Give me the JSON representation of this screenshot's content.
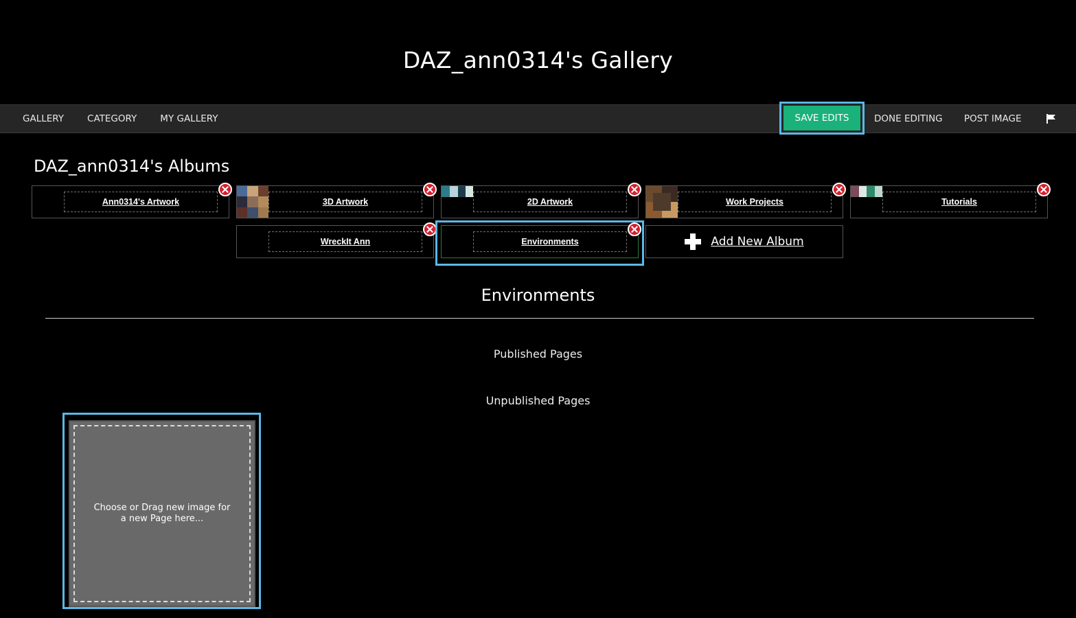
{
  "page": {
    "title": "DAZ_ann0314's Gallery"
  },
  "nav": {
    "left": [
      "GALLERY",
      "CATEGORY",
      "MY GALLERY"
    ],
    "save_label": "SAVE EDITS",
    "done_label": "DONE EDITING",
    "post_label": "POST IMAGE",
    "flag_icon": "flag-icon"
  },
  "albums": {
    "heading": "DAZ_ann0314's Albums",
    "items": [
      {
        "label": "Ann0314's Artwork"
      },
      {
        "label": "3D Artwork"
      },
      {
        "label": "2D Artwork"
      },
      {
        "label": "Work Projects"
      },
      {
        "label": "Tutorials"
      },
      {
        "label": "WreckIt Ann"
      },
      {
        "label": "Environments",
        "selected": true
      }
    ],
    "add_label": "Add New Album",
    "delete_icon": "close-circle-icon",
    "add_icon": "plus-icon"
  },
  "current_album": {
    "title": "Environments",
    "published_label": "Published Pages",
    "unpublished_label": "Unpublished Pages",
    "drop_text": "Choose or Drag new image for a new Page here..."
  },
  "colors": {
    "accent_green": "#1ab27a",
    "highlight_blue": "#5bb8e6",
    "delete_red": "#d3202e",
    "navbar_bg": "#262626"
  }
}
